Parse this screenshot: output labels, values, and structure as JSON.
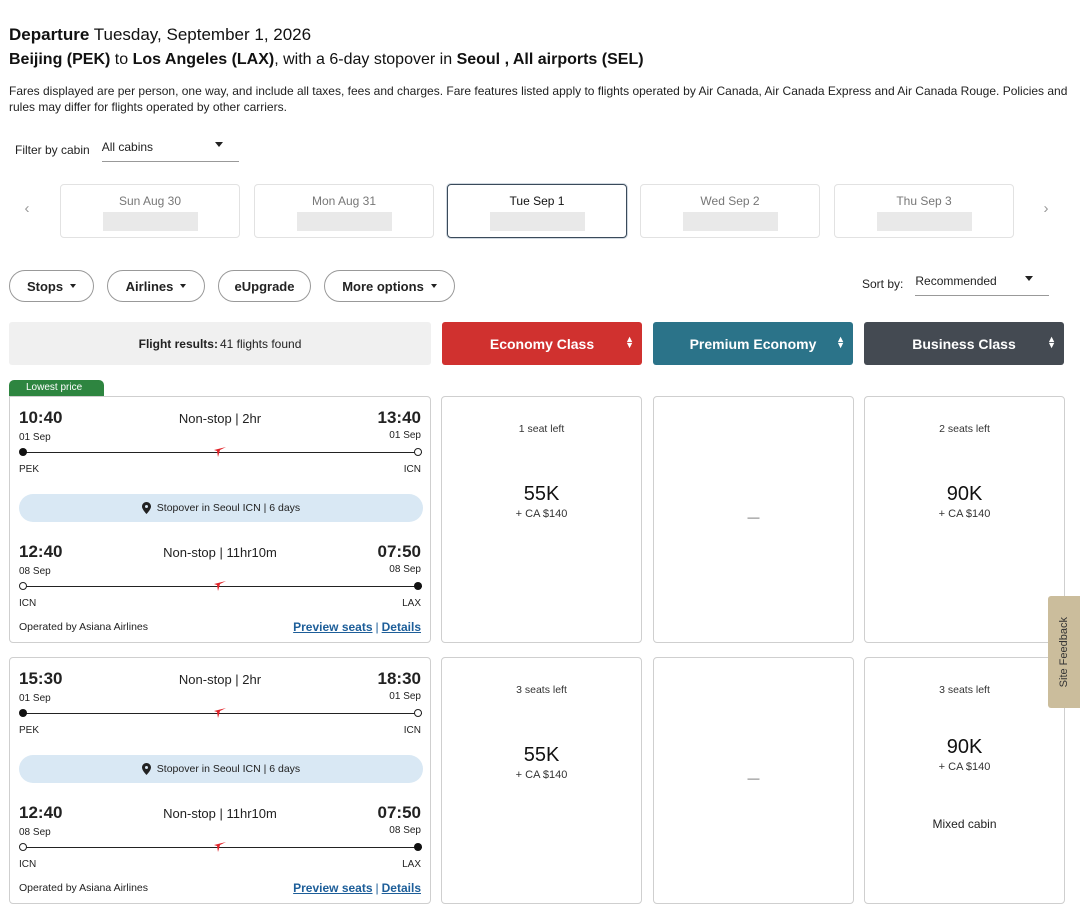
{
  "header": {
    "departure_label": "Departure",
    "departure_date": "Tuesday, September 1, 2026",
    "origin": "Beijing (PEK)",
    "to": "to",
    "destination": "Los Angeles (LAX)",
    "stopover_text": ", with a 6-day stopover in",
    "stopover_city": "Seoul , All airports (SEL)",
    "note": "Fares displayed are per person, one way, and include all taxes, fees and charges. Fare features listed apply to flights operated by Air Canada, Air Canada Express and Air Canada Rouge. Policies and rules may differ for flights operated by other carriers."
  },
  "filter": {
    "label": "Filter by cabin",
    "value": "All cabins"
  },
  "dates": [
    {
      "label": "Sun Aug 30"
    },
    {
      "label": "Mon Aug 31"
    },
    {
      "label": "Tue Sep 1",
      "selected": true
    },
    {
      "label": "Wed Sep 2"
    },
    {
      "label": "Thu Sep 3"
    }
  ],
  "nav": {
    "prev": "‹",
    "next": "›"
  },
  "pills": {
    "stops": "Stops",
    "airlines": "Airlines",
    "eupgrade": "eUpgrade",
    "more": "More options"
  },
  "sort": {
    "label": "Sort by:",
    "value": "Recommended"
  },
  "results": {
    "label": "Flight results:",
    "count": "41 flights found"
  },
  "cabins": {
    "economy": "Economy Class",
    "premium": "Premium Economy",
    "business": "Business Class"
  },
  "badge": {
    "lowest": "Lowest price"
  },
  "flights": [
    {
      "seg1": {
        "dep_time": "10:40",
        "dep_date": "01 Sep",
        "dep_airport": "PEK",
        "info": "Non-stop | 2hr",
        "arr_time": "13:40",
        "arr_date": "01 Sep",
        "arr_airport": "ICN"
      },
      "stopover": "Stopover in Seoul ICN | 6 days",
      "seg2": {
        "dep_time": "12:40",
        "dep_date": "08 Sep",
        "dep_airport": "ICN",
        "info": "Non-stop | 11hr10m",
        "arr_time": "07:50",
        "arr_date": "08 Sep",
        "arr_airport": "LAX"
      },
      "operated_by": "Operated by Asiana Airlines",
      "preview_seats": "Preview seats",
      "sep": "|",
      "details": "Details",
      "economy": {
        "seats": "1 seat left",
        "points": "55K",
        "fee": "+ CA $140"
      },
      "premium": {
        "dash": "—"
      },
      "business": {
        "seats": "2 seats left",
        "points": "90K",
        "fee": "+ CA $140",
        "extra": ""
      }
    },
    {
      "seg1": {
        "dep_time": "15:30",
        "dep_date": "01 Sep",
        "dep_airport": "PEK",
        "info": "Non-stop | 2hr",
        "arr_time": "18:30",
        "arr_date": "01 Sep",
        "arr_airport": "ICN"
      },
      "stopover": "Stopover in Seoul ICN | 6 days",
      "seg2": {
        "dep_time": "12:40",
        "dep_date": "08 Sep",
        "dep_airport": "ICN",
        "info": "Non-stop | 11hr10m",
        "arr_time": "07:50",
        "arr_date": "08 Sep",
        "arr_airport": "LAX"
      },
      "operated_by": "Operated by Asiana Airlines",
      "preview_seats": "Preview seats",
      "sep": "|",
      "details": "Details",
      "economy": {
        "seats": "3 seats left",
        "points": "55K",
        "fee": "+ CA $140"
      },
      "premium": {
        "dash": "—"
      },
      "business": {
        "seats": "3 seats left",
        "points": "90K",
        "fee": "+ CA $140",
        "extra": "Mixed cabin"
      }
    }
  ],
  "feedback": "Site Feedback",
  "colors": {
    "economy": "#d0312f",
    "premium": "#2b7389",
    "business": "#444a52",
    "lowest_badge": "#2e8540",
    "link": "#1d5e99",
    "plane_logo": "#e0242a"
  }
}
